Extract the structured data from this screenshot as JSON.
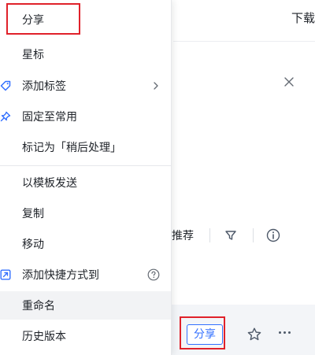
{
  "background": {
    "download_label": "下载",
    "recommend_label": "推荐",
    "share_button_label": "分享"
  },
  "menu": {
    "items": [
      {
        "label": "分享"
      },
      {
        "label": "星标"
      },
      {
        "label": "添加标签"
      },
      {
        "label": "固定至常用"
      },
      {
        "label": "标记为「稍后处理」"
      },
      {
        "label": "以模板发送"
      },
      {
        "label": "复制"
      },
      {
        "label": "移动"
      },
      {
        "label": "添加快捷方式到"
      },
      {
        "label": "重命名"
      },
      {
        "label": "历史版本"
      }
    ]
  },
  "colors": {
    "accent": "#3370ff",
    "highlight": "#e0212a",
    "hover": "#f2f3f5"
  }
}
